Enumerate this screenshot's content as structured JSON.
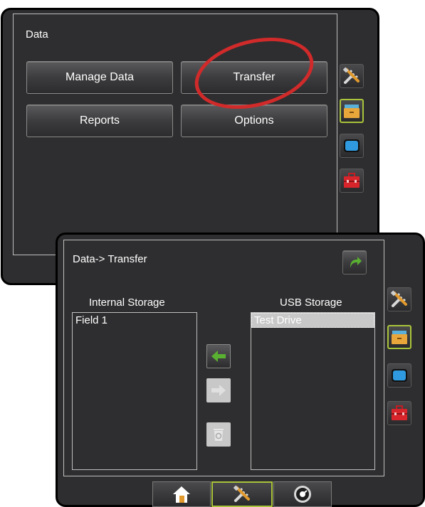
{
  "back_screen": {
    "title": "Data",
    "buttons": {
      "manage_data": "Manage Data",
      "transfer": "Transfer",
      "reports": "Reports",
      "options": "Options"
    }
  },
  "front_screen": {
    "title": "Data-> Transfer",
    "internal_storage": {
      "label": "Internal Storage",
      "items": [
        "Field 1"
      ]
    },
    "usb_storage": {
      "label": "USB Storage",
      "items": [
        "Test Drive"
      ]
    }
  },
  "side_nav": [
    "tools-icon",
    "data-drawer-icon",
    "monitor-icon",
    "toolbox-icon"
  ],
  "bottom_nav": [
    "home-icon",
    "tools-icon",
    "gauge-icon"
  ],
  "colors": {
    "background": "#2e2e30",
    "active_outline": "#a8c43a",
    "callout": "#d12a2a",
    "arrow_green": "#5ab031",
    "disabled": "#c8c8c8"
  }
}
